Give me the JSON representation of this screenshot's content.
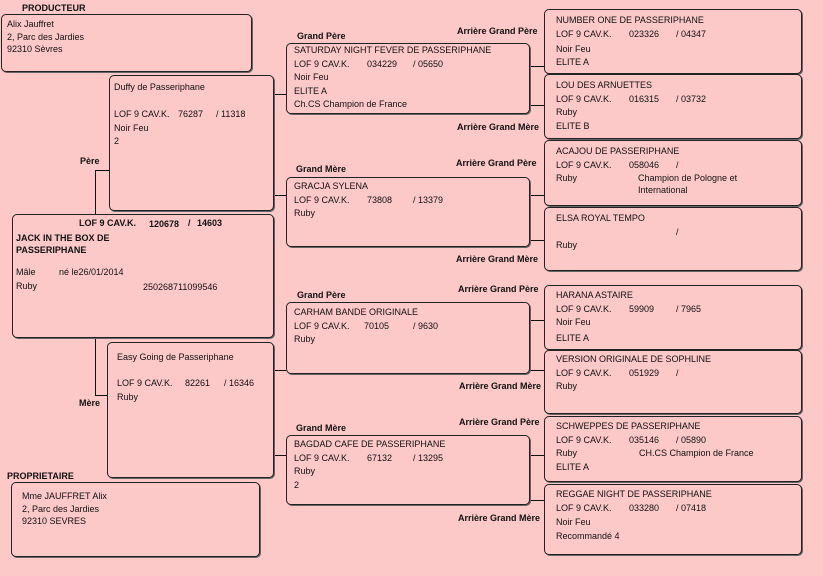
{
  "producer": {
    "label": "PRODUCTEUR",
    "name": "Alix Jauffret",
    "address1": "2, Parc des Jardies",
    "address2": "92310 Sèvres"
  },
  "owner": {
    "label": "PROPRIETAIRE",
    "name": "Mme JAUFFRET Alix",
    "address1": "2, Parc des Jardies",
    "address2": "92310 SEVRES"
  },
  "subject": {
    "lof": "LOF 9 CAV.K.",
    "lof_num": "120678",
    "sep": "/",
    "lof_num2": "14603",
    "name1": "JACK IN THE BOX DE",
    "name2": "PASSERIPHANE",
    "sex": "Mâle",
    "born": "né le26/01/2014",
    "color": "Ruby",
    "chip": "250268711099546"
  },
  "labels": {
    "pere": "Père",
    "mere": "Mère",
    "grand_pere": "Grand Père",
    "grand_mere": "Grand Mère",
    "agp": "Arrière Grand Père",
    "agm": "Arrière Grand Mère"
  },
  "father": {
    "name": "Duffy de Passeriphane",
    "lof": "LOF 9 CAV.K.",
    "num": "76287",
    "num2": "/ 11318",
    "color": "Noir Feu",
    "extra": "2"
  },
  "mother": {
    "name": "Easy Going de Passeriphane",
    "lof": "LOF 9 CAV.K.",
    "num": "82261",
    "num2": "/ 16346",
    "color": "Ruby"
  },
  "gp1": {
    "name": "SATURDAY NIGHT FEVER DE PASSERIPHANE",
    "lof": "LOF 9 CAV.K.",
    "num": "034229",
    "num2": "/ 05650",
    "color": "Noir Feu",
    "t1": "ELITE A",
    "t2": "Ch.CS Champion de France"
  },
  "gm1": {
    "name": "GRACJA SYLENA",
    "lof": "LOF 9 CAV.K.",
    "num": "73808",
    "num2": "/ 13379",
    "color": "Ruby"
  },
  "gp2": {
    "name": "CARHAM BANDE ORIGINALE",
    "lof": "LOF 9 CAV.K.",
    "num": "70105",
    "num2": "/ 9630",
    "color": "Ruby"
  },
  "gm2": {
    "name": "BAGDAD CAFE DE PASSERIPHANE",
    "lof": "LOF 9 CAV.K.",
    "num": "67132",
    "num2": "/ 13295",
    "color": "Ruby",
    "extra": "2"
  },
  "ggp1": {
    "name": "NUMBER ONE DE PASSERIPHANE",
    "lof": "LOF 9 CAV.K.",
    "num": "023326",
    "num2": "/ 04347",
    "color": "Noir Feu",
    "t1": "ELITE A"
  },
  "ggm1": {
    "name": "LOU DES ARNUETTES",
    "lof": "LOF 9 CAV.K.",
    "num": "016315",
    "num2": "/ 03732",
    "color": "Ruby",
    "t1": "ELITE B"
  },
  "ggp2": {
    "name": "ACAJOU DE PASSERIPHANE",
    "lof": "LOF 9 CAV.K.",
    "num": "058046",
    "num2": "/",
    "color": "Ruby",
    "t1": "Champion de Pologne et",
    "t2": "International"
  },
  "ggm2": {
    "name": "ELSA ROYAL TEMPO",
    "num2": "/",
    "color": "Ruby"
  },
  "ggp3": {
    "name": "HARANA ASTAIRE",
    "lof": "LOF 9 CAV.K.",
    "num": "59909",
    "num2": "/ 7965",
    "color": "Noir Feu",
    "t1": "ELITE A"
  },
  "ggm3": {
    "name": "VERSION ORIGINALE DE SOPHLINE",
    "lof": "LOF 9 CAV.K.",
    "num": "051929",
    "num2": "/",
    "color": "Ruby"
  },
  "ggp4": {
    "name": "SCHWEPPES DE PASSERIPHANE",
    "lof": "LOF 9 CAV.K.",
    "num": "035146",
    "num2": "/ 05890",
    "color": "Ruby",
    "t1": "CH.CS Champion de France",
    "t2": "ELITE A"
  },
  "ggm4": {
    "name": "REGGAE NIGHT DE PASSERIPHANE",
    "lof": "LOF 9 CAV.K.",
    "num": "033280",
    "num2": "/ 07418",
    "color": "Noir Feu",
    "t1": "Recommandé 4"
  }
}
